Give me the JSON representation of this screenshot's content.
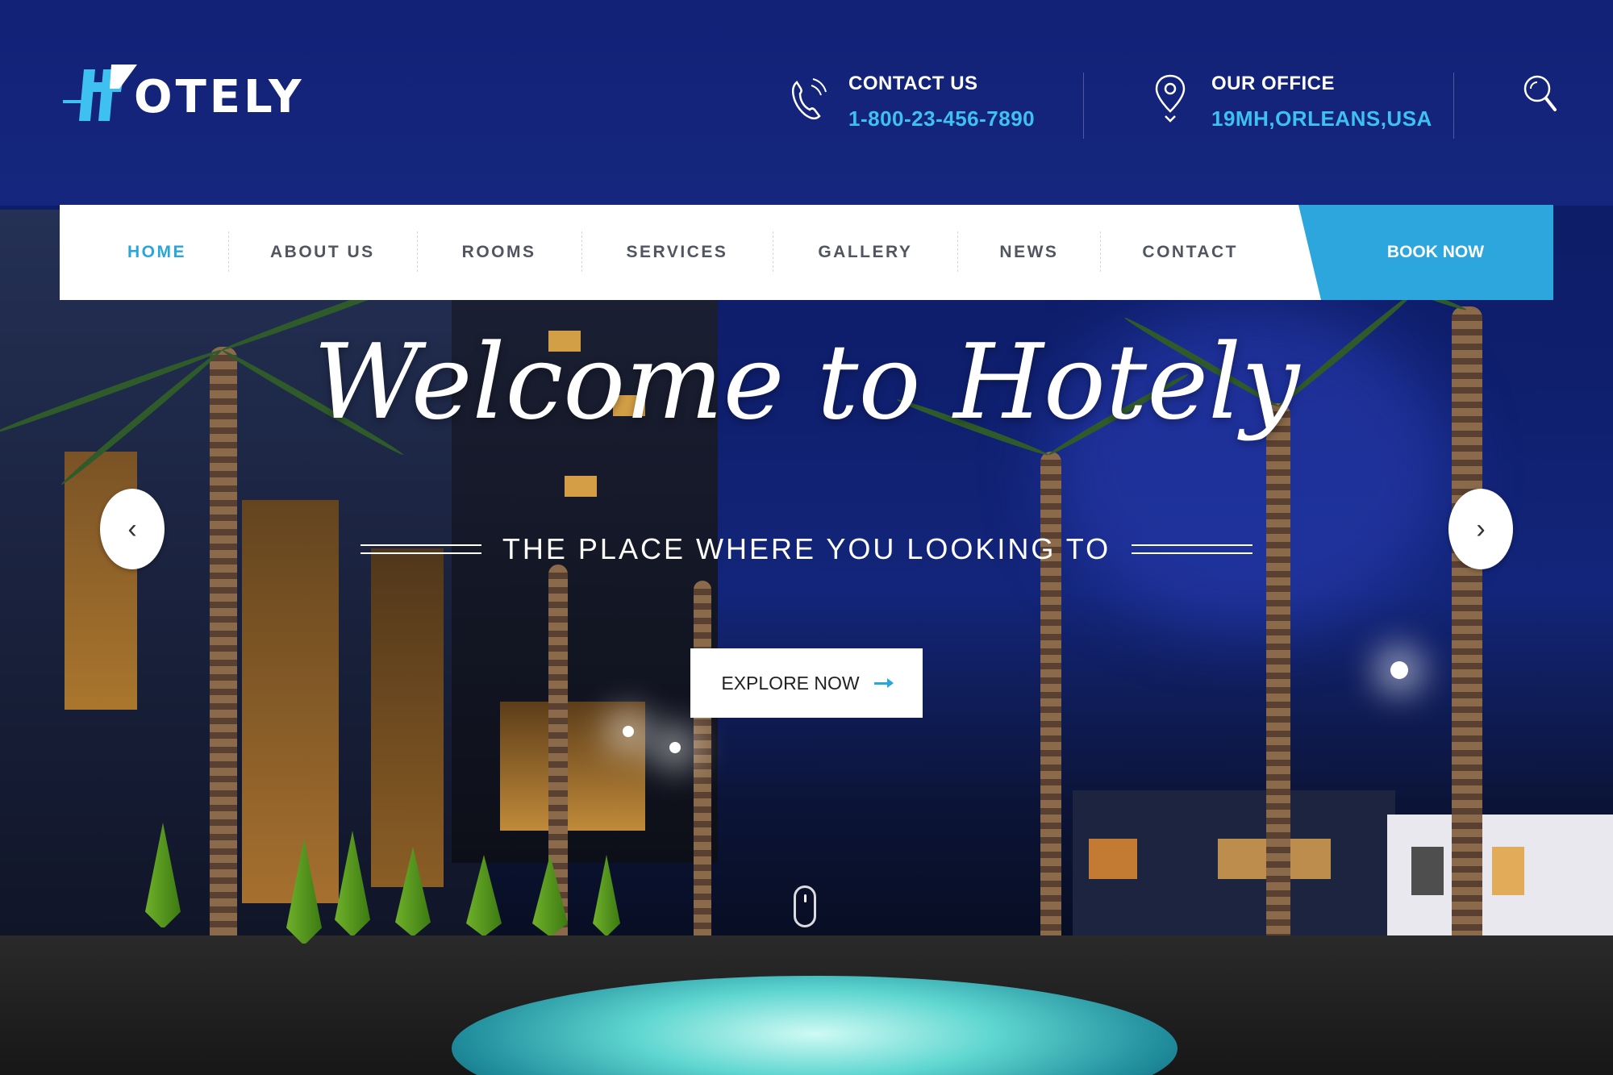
{
  "header": {
    "logo_text": "OTELY",
    "contact": {
      "label": "CONTACT US",
      "value": "1-800-23-456-7890",
      "icon": "phone-icon"
    },
    "office": {
      "label": "OUR OFFICE",
      "value": "19MH,ORLEANS,USA",
      "icon": "map-pin-icon"
    },
    "search_icon": "search-icon"
  },
  "nav": {
    "items": [
      {
        "label": "HOME",
        "active": true
      },
      {
        "label": "ABOUT US",
        "active": false
      },
      {
        "label": "ROOMS",
        "active": false
      },
      {
        "label": "SERVICES",
        "active": false
      },
      {
        "label": "GALLERY",
        "active": false
      },
      {
        "label": "NEWS",
        "active": false
      },
      {
        "label": "CONTACT",
        "active": false
      }
    ],
    "book_now": "BOOK NOW"
  },
  "hero": {
    "title": "Welcome to Hotely",
    "tagline": "THE PLACE WHERE YOU LOOKING TO",
    "cta": "EXPLORE NOW",
    "prev": "‹",
    "next": "›"
  },
  "colors": {
    "accent": "#2aa6d8",
    "header_bg": "#16287f",
    "contact_value": "#3ec1f0"
  }
}
